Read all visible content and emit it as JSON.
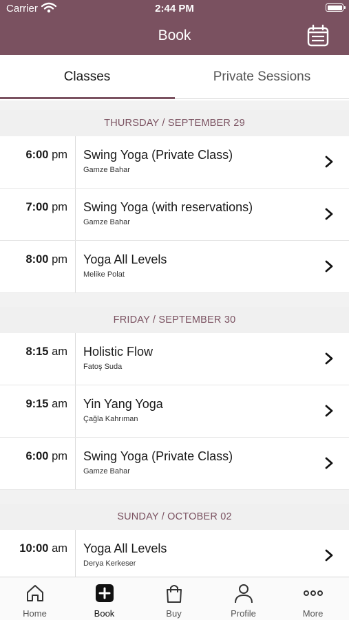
{
  "status_bar": {
    "carrier": "Carrier",
    "time": "2:44 PM"
  },
  "nav": {
    "title": "Book",
    "calendar_icon": "calendar-icon"
  },
  "tabs": [
    {
      "label": "Classes",
      "selected": true
    },
    {
      "label": "Private Sessions",
      "selected": false
    }
  ],
  "days": [
    {
      "header": "THURSDAY / SEPTEMBER 29",
      "classes": [
        {
          "time": "6:00",
          "ampm": "pm",
          "name": "Swing Yoga (Private Class)",
          "teacher": "Gamze Bahar"
        },
        {
          "time": "7:00",
          "ampm": "pm",
          "name": "Swing Yoga (with reservations)",
          "teacher": "Gamze Bahar"
        },
        {
          "time": "8:00",
          "ampm": "pm",
          "name": "Yoga All Levels",
          "teacher": "Melike Polat"
        }
      ]
    },
    {
      "header": "FRIDAY / SEPTEMBER 30",
      "classes": [
        {
          "time": "8:15",
          "ampm": "am",
          "name": "Holistic Flow",
          "teacher": "Fatoş Suda"
        },
        {
          "time": "9:15",
          "ampm": "am",
          "name": "Yin Yang Yoga",
          "teacher": "Çağla Kahrıman"
        },
        {
          "time": "6:00",
          "ampm": "pm",
          "name": "Swing Yoga (Private Class)",
          "teacher": "Gamze Bahar"
        }
      ]
    },
    {
      "header": "SUNDAY / OCTOBER 02",
      "classes": [
        {
          "time": "10:00",
          "ampm": "am",
          "name": "Yoga All Levels",
          "teacher": "Derya Kerkeser"
        }
      ]
    }
  ],
  "tab_bar": [
    {
      "label": "Home",
      "icon": "home-icon",
      "active": false
    },
    {
      "label": "Book",
      "icon": "plus-square-icon",
      "active": true
    },
    {
      "label": "Buy",
      "icon": "shopping-bag-icon",
      "active": false
    },
    {
      "label": "Profile",
      "icon": "person-icon",
      "active": false
    },
    {
      "label": "More",
      "icon": "more-dots-icon",
      "active": false
    }
  ],
  "colors": {
    "brand": "#7a5160",
    "background": "#f2f2f2",
    "text": "#1a1a1a"
  }
}
